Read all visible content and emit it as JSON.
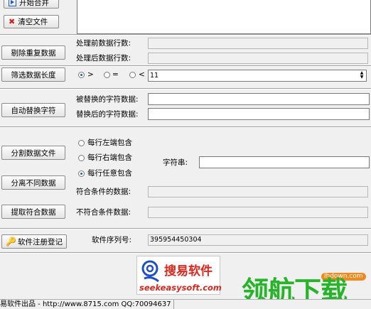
{
  "toolbar": {
    "merge_label": "开始合并",
    "clear_label": "清空文件"
  },
  "dedupe": {
    "button": "剔除重复数据",
    "before_label": "处理前数据行数:",
    "after_label": "处理后数据行数:"
  },
  "filter_length": {
    "button": "筛选数据长度",
    "options": [
      ">",
      "=",
      "<"
    ],
    "selected": ">",
    "value": "11"
  },
  "replace": {
    "button": "自动替换字符",
    "from_label": "被替换的字符数据:",
    "to_label": "替换后的字符数据:"
  },
  "split": {
    "split_button": "分割数据文件",
    "separate_button": "分离不同数据",
    "extract_button": "提取符合数据",
    "options": [
      "每行左端包含",
      "每行右端包含",
      "每行任意包含"
    ],
    "selected": "每行任意包含",
    "string_label": "字符串:",
    "match_label": "符合条件的数据:",
    "nomatch_label": "不符合条件数据:"
  },
  "register": {
    "button": "软件注册登记",
    "serial_label": "软件序列号:",
    "serial_value": "395954450304"
  },
  "logo": {
    "cn_text": "搜易软件",
    "en_text": "seekeasysoft.com"
  },
  "watermark": {
    "cn_text": "领航下载",
    "site": "lhdown.com"
  },
  "statusbar": {
    "text": "易软件出品 - http://www.8715.com QQ:70094637"
  },
  "colors": {
    "accent": "#1a5bd6",
    "logo_blue": "#1f4fc8",
    "logo_red": "#e0261c",
    "watermark_green": "#27b42a"
  }
}
